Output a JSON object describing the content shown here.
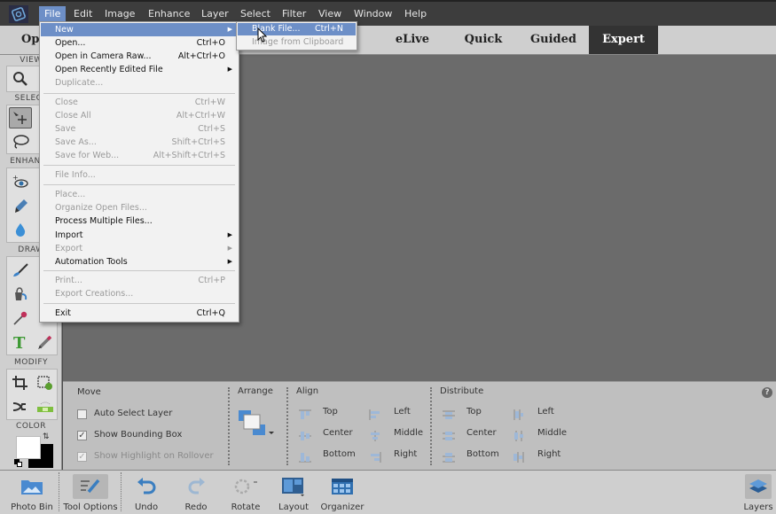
{
  "menubar": {
    "items": [
      "File",
      "Edit",
      "Image",
      "Enhance",
      "Layer",
      "Select",
      "Filter",
      "View",
      "Window",
      "Help"
    ],
    "active": "File"
  },
  "modebar": {
    "open_label": "Open",
    "tabs": [
      "eLive",
      "Quick",
      "Guided",
      "Expert"
    ],
    "active_tab": "Expert"
  },
  "toolbox": {
    "sections": {
      "view": "VIEW",
      "select": "SELECT",
      "enhance": "ENHANCE",
      "draw": "DRAW",
      "modify": "MODIFY",
      "color": "COLOR"
    },
    "tools": [
      "zoom-icon",
      "move-icon",
      "lasso-icon",
      "red-eye-icon",
      "spot-healing-icon",
      "blur-icon",
      "brush-icon",
      "paint-bucket-icon",
      "eyedropper-icon",
      "type-icon",
      "pencil-icon",
      "crop-icon",
      "recompose-icon",
      "content-aware-move-icon",
      "straighten-icon"
    ]
  },
  "file_menu": {
    "items": [
      {
        "label": "New",
        "shortcut": "",
        "submenu": true,
        "disabled": false,
        "highlighted": true
      },
      {
        "label": "Open...",
        "shortcut": "Ctrl+O",
        "submenu": false,
        "disabled": false
      },
      {
        "label": "Open in Camera Raw...",
        "shortcut": "Alt+Ctrl+O",
        "submenu": false,
        "disabled": false
      },
      {
        "label": "Open Recently Edited File",
        "shortcut": "",
        "submenu": true,
        "disabled": false
      },
      {
        "label": "Duplicate...",
        "shortcut": "",
        "submenu": false,
        "disabled": true
      },
      {
        "label": "Close",
        "shortcut": "Ctrl+W",
        "submenu": false,
        "disabled": true
      },
      {
        "label": "Close All",
        "shortcut": "Alt+Ctrl+W",
        "submenu": false,
        "disabled": true
      },
      {
        "label": "Save",
        "shortcut": "Ctrl+S",
        "submenu": false,
        "disabled": true
      },
      {
        "label": "Save As...",
        "shortcut": "Shift+Ctrl+S",
        "submenu": false,
        "disabled": true
      },
      {
        "label": "Save for Web...",
        "shortcut": "Alt+Shift+Ctrl+S",
        "submenu": false,
        "disabled": true
      },
      {
        "label": "File Info...",
        "shortcut": "",
        "submenu": false,
        "disabled": true
      },
      {
        "label": "Place...",
        "shortcut": "",
        "submenu": false,
        "disabled": true
      },
      {
        "label": "Organize Open Files...",
        "shortcut": "",
        "submenu": false,
        "disabled": true
      },
      {
        "label": "Process Multiple Files...",
        "shortcut": "",
        "submenu": false,
        "disabled": false
      },
      {
        "label": "Import",
        "shortcut": "",
        "submenu": true,
        "disabled": false
      },
      {
        "label": "Export",
        "shortcut": "",
        "submenu": true,
        "disabled": true
      },
      {
        "label": "Automation Tools",
        "shortcut": "",
        "submenu": true,
        "disabled": false
      },
      {
        "label": "Print...",
        "shortcut": "Ctrl+P",
        "submenu": false,
        "disabled": true
      },
      {
        "label": "Export Creations...",
        "shortcut": "",
        "submenu": false,
        "disabled": true
      },
      {
        "label": "Exit",
        "shortcut": "Ctrl+Q",
        "submenu": false,
        "disabled": false
      }
    ]
  },
  "new_submenu": {
    "items": [
      {
        "label": "Blank File...",
        "shortcut": "Ctrl+N",
        "highlighted": true,
        "disabled": false
      },
      {
        "label": "Image from Clipboard",
        "shortcut": "",
        "highlighted": false,
        "disabled": true
      }
    ]
  },
  "tool_options": {
    "move": {
      "title": "Move",
      "checkboxes": [
        {
          "label": "Auto Select Layer",
          "checked": false,
          "disabled": false
        },
        {
          "label": "Show Bounding Box",
          "checked": true,
          "disabled": false
        },
        {
          "label": "Show Highlight on Rollover",
          "checked": true,
          "disabled": true
        }
      ]
    },
    "arrange": {
      "title": "Arrange"
    },
    "align": {
      "title": "Align",
      "col1": [
        "Top",
        "Center",
        "Bottom"
      ],
      "col2": [
        "Left",
        "Middle",
        "Right"
      ]
    },
    "distribute": {
      "title": "Distribute",
      "col1": [
        "Top",
        "Center",
        "Bottom"
      ],
      "col2": [
        "Left",
        "Middle",
        "Right"
      ]
    },
    "help": "?"
  },
  "bottombar": {
    "buttons": [
      "Photo Bin",
      "Tool Options",
      "Undo",
      "Redo",
      "Rotate",
      "Layout",
      "Organizer"
    ],
    "active": "Tool Options",
    "right_button": "Layers"
  },
  "colors": {
    "accent": "#6d8fc7",
    "menubar": "#3d3d3d",
    "canvas": "#6b6b6b",
    "panel": "#cfcfcf"
  }
}
